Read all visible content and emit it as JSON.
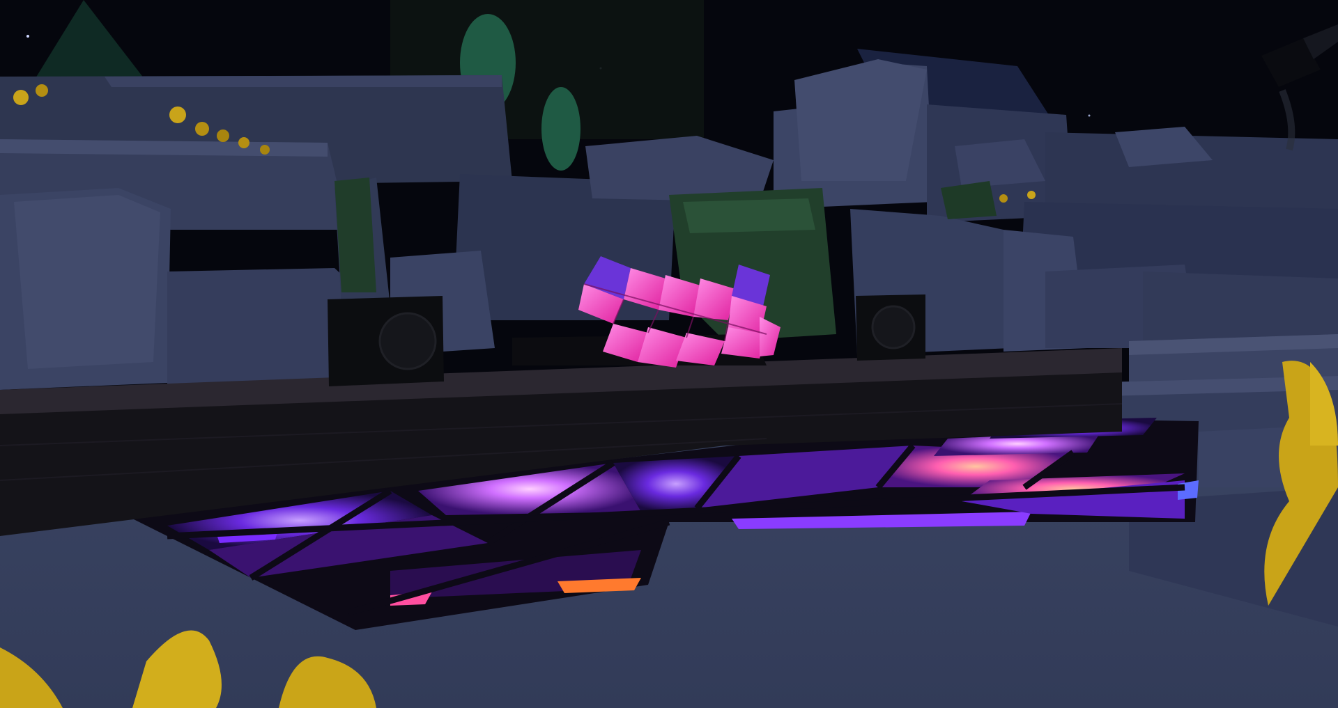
{
  "scene": {
    "view": "night-garden-dance-floor",
    "ui_text": []
  },
  "palette": {
    "sky": "#05060d",
    "rock_light": "#3e4766",
    "rock_mid": "#313956",
    "rock_dark": "#222840",
    "ground": "#3b4563",
    "stage_top": "#2a2730",
    "stage_front": "#141318",
    "speaker": "#0c0d10",
    "floor_glow_purple": "#7a2cff",
    "floor_glow_pink": "#ff6fd8",
    "floor_glow_orange": "#ff7a2e",
    "dj_booth_pink": "#ff3fc8",
    "flower_yellow": "#d9b21a",
    "foliage_green": "#1f3d2a"
  },
  "icons": {
    "speaker_left": "speaker-icon",
    "speaker_right": "speaker-icon",
    "dj_booth": "dj-booth-icon",
    "spotlight": "spotlight-icon",
    "flowers": "flower-icon"
  }
}
